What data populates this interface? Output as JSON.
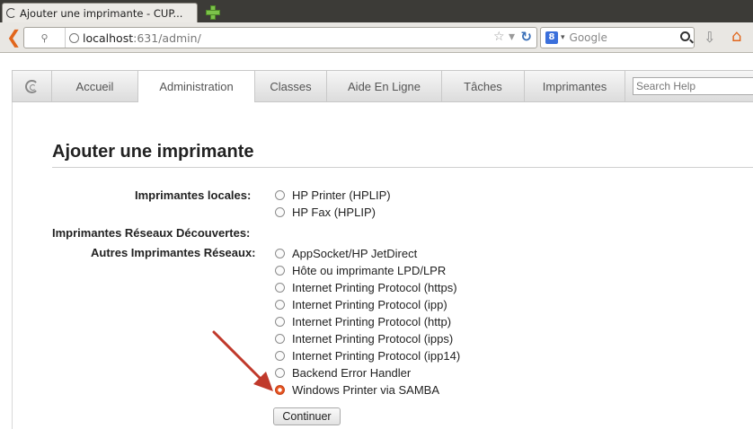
{
  "browser": {
    "tab_title": "Ajouter une imprimante - CUP...",
    "url_host": "localhost",
    "url_path": ":631/admin/",
    "search_placeholder": "Google",
    "search_engine_letter": "8",
    "colors": {
      "accent_orange": "#e1661c",
      "tabstrip": "#3c3b37"
    },
    "icons": [
      "back-arrow-icon",
      "identity-icon",
      "globe-icon",
      "bookmark-star-icon",
      "reload-icon",
      "google-icon",
      "search-icon",
      "download-icon",
      "home-icon",
      "new-tab-icon"
    ]
  },
  "cups_menu": {
    "items": [
      {
        "label": "Accueil"
      },
      {
        "label": "Administration",
        "active": true
      },
      {
        "label": "Classes"
      },
      {
        "label": "Aide En Ligne"
      },
      {
        "label": "Tâches"
      },
      {
        "label": "Imprimantes"
      }
    ],
    "search_placeholder": "Search Help"
  },
  "page": {
    "title": "Ajouter une imprimante",
    "groups": {
      "local_label": "Imprimantes locales:",
      "discovered_label": "Imprimantes Réseaux Découvertes:",
      "other_label": "Autres Imprimantes Réseaux:"
    },
    "local_options": [
      "HP Printer (HPLIP)",
      "HP Fax (HPLIP)"
    ],
    "other_options": [
      "AppSocket/HP JetDirect",
      "Hôte ou imprimante LPD/LPR",
      "Internet Printing Protocol (https)",
      "Internet Printing Protocol (ipp)",
      "Internet Printing Protocol (http)",
      "Internet Printing Protocol (ipps)",
      "Internet Printing Protocol (ipp14)",
      "Backend Error Handler",
      "Windows Printer via SAMBA"
    ],
    "selected_option": "Windows Printer via SAMBA",
    "continue_label": "Continuer",
    "annotation_arrow_color": "#c0392b"
  }
}
